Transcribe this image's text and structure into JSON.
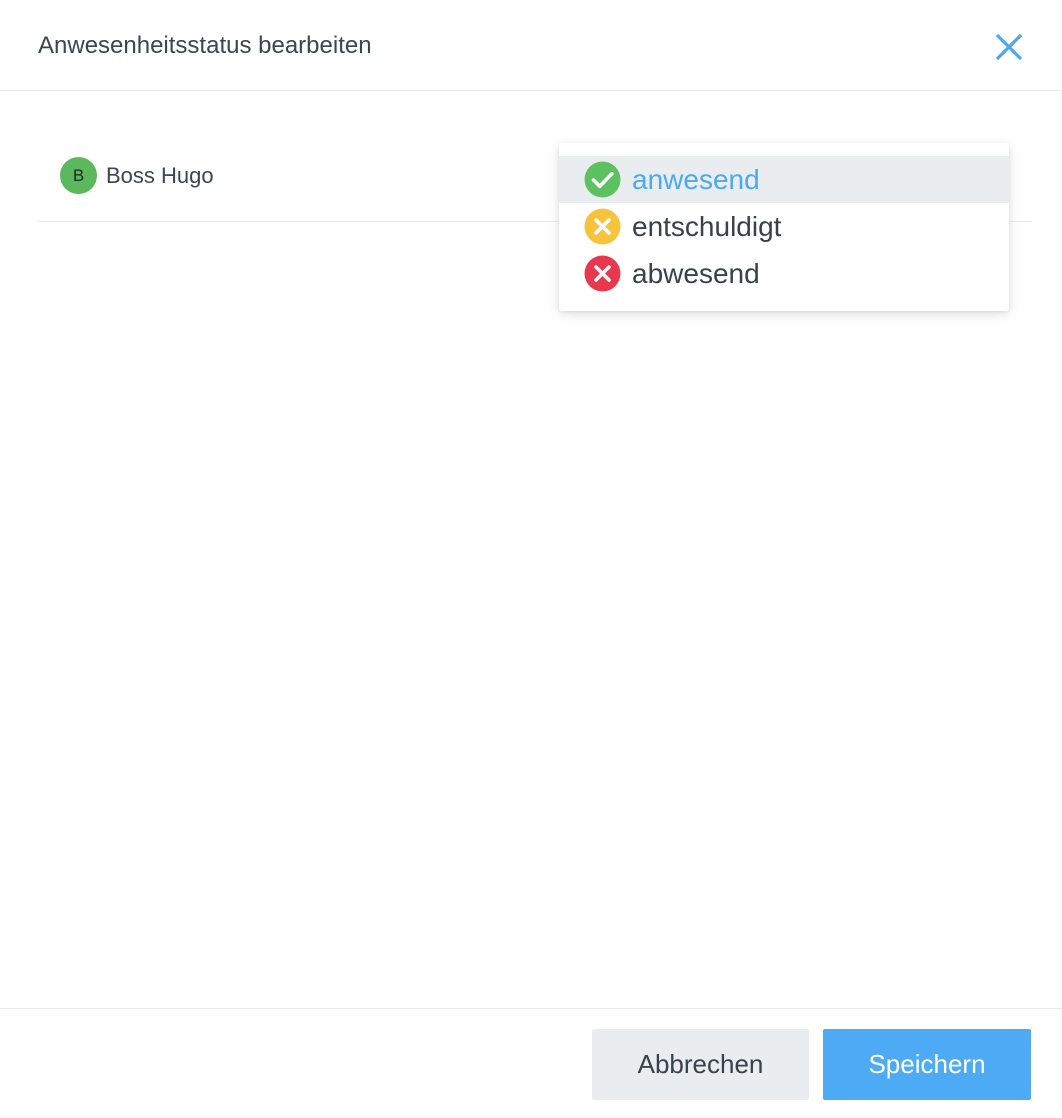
{
  "dialog": {
    "title": "Anwesenheitsstatus bearbeiten",
    "close_icon": "close-icon"
  },
  "member": {
    "avatar_initial": "B",
    "name": "Boss Hugo"
  },
  "status_dropdown": {
    "options": [
      {
        "label": "anwesend",
        "icon": "check-circle-icon",
        "color": "#5cc160",
        "highlighted": true
      },
      {
        "label": "entschuldigt",
        "icon": "x-circle-icon",
        "color": "#f6c33b",
        "highlighted": false
      },
      {
        "label": "abwesend",
        "icon": "x-circle-icon",
        "color": "#e8384f",
        "highlighted": false
      }
    ]
  },
  "footer": {
    "cancel_label": "Abbrechen",
    "save_label": "Speichern"
  },
  "colors": {
    "accent": "#4dabf5",
    "avatar_bg": "#5cb85c"
  }
}
